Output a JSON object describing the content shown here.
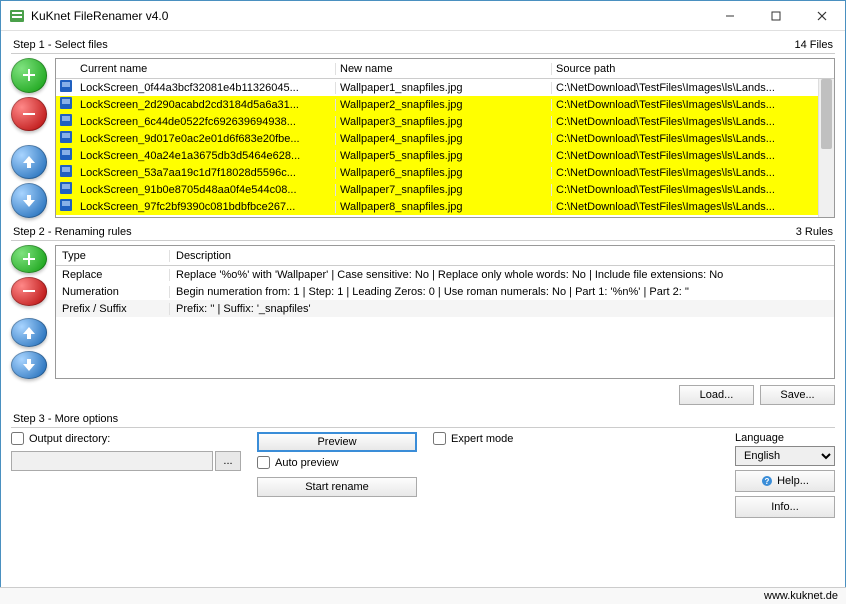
{
  "window": {
    "title": "KuKnet FileRenamer v4.0"
  },
  "step1": {
    "label": "Step 1 - Select files",
    "count": "14 Files",
    "columns": {
      "c1": "Current name",
      "c2": "New name",
      "c3": "Source path"
    },
    "rows": [
      {
        "hl": false,
        "cur": "LockScreen_0f44a3bcf32081e4b11326045...",
        "new": "Wallpaper1_snapfiles.jpg",
        "path": "C:\\NetDownload\\TestFiles\\Images\\ls\\Lands..."
      },
      {
        "hl": true,
        "cur": "LockScreen_2d290acabd2cd3184d5a6a31...",
        "new": "Wallpaper2_snapfiles.jpg",
        "path": "C:\\NetDownload\\TestFiles\\Images\\ls\\Lands..."
      },
      {
        "hl": true,
        "cur": "LockScreen_6c44de0522fc692639694938...",
        "new": "Wallpaper3_snapfiles.jpg",
        "path": "C:\\NetDownload\\TestFiles\\Images\\ls\\Lands..."
      },
      {
        "hl": true,
        "cur": "LockScreen_9d017e0ac2e01d6f683e20fbe...",
        "new": "Wallpaper4_snapfiles.jpg",
        "path": "C:\\NetDownload\\TestFiles\\Images\\ls\\Lands..."
      },
      {
        "hl": true,
        "cur": "LockScreen_40a24e1a3675db3d5464e628...",
        "new": "Wallpaper5_snapfiles.jpg",
        "path": "C:\\NetDownload\\TestFiles\\Images\\ls\\Lands..."
      },
      {
        "hl": true,
        "cur": "LockScreen_53a7aa19c1d7f18028d5596c...",
        "new": "Wallpaper6_snapfiles.jpg",
        "path": "C:\\NetDownload\\TestFiles\\Images\\ls\\Lands..."
      },
      {
        "hl": true,
        "cur": "LockScreen_91b0e8705d48aa0f4e544c08...",
        "new": "Wallpaper7_snapfiles.jpg",
        "path": "C:\\NetDownload\\TestFiles\\Images\\ls\\Lands..."
      },
      {
        "hl": true,
        "cur": "LockScreen_97fc2bf9390c081bdbfbce267...",
        "new": "Wallpaper8_snapfiles.jpg",
        "path": "C:\\NetDownload\\TestFiles\\Images\\ls\\Lands..."
      }
    ]
  },
  "step2": {
    "label": "Step 2 - Renaming rules",
    "count": "3 Rules",
    "columns": {
      "c1": "Type",
      "c2": "Description"
    },
    "rules": [
      {
        "hl": false,
        "type": "Replace",
        "desc": "Replace '%o%' with 'Wallpaper' | Case sensitive: No | Replace only whole words: No | Include file extensions: No"
      },
      {
        "hl": false,
        "type": "Numeration",
        "desc": "Begin numeration from: 1 | Step: 1 | Leading Zeros: 0 | Use roman numerals: No | Part 1: '%n%' | Part 2: ''"
      },
      {
        "hl": true,
        "type": "Prefix / Suffix",
        "desc": "Prefix: '' | Suffix: '_snapfiles'"
      }
    ],
    "load": "Load...",
    "save": "Save..."
  },
  "step3": {
    "label": "Step 3 - More options",
    "output_dir_label": "Output directory:",
    "browse": "...",
    "preview": "Preview",
    "auto_preview": "Auto preview",
    "start_rename": "Start rename",
    "expert": "Expert mode",
    "language_label": "Language",
    "language_value": "English",
    "help": "Help...",
    "info": "Info..."
  },
  "footer": {
    "url": "www.kuknet.de"
  }
}
